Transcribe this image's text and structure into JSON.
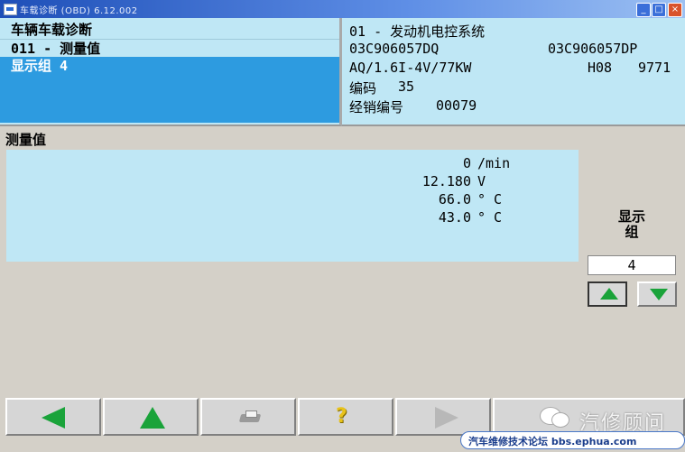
{
  "window": {
    "title": "车载诊断 (OBD) 6.12.002"
  },
  "left_header": {
    "rows": [
      "车辆车载诊断",
      "011 - 测量值"
    ],
    "selected": "显示组 4"
  },
  "right_header": {
    "system": "01 - 发动机电控系统",
    "part_left": "03C906057DQ",
    "part_right": "03C906057DP",
    "engine": "AQ/1.6I-4V/77KW",
    "code_a": "H08",
    "code_b": "9771",
    "coding_label": "编码",
    "coding_value": "35",
    "dealer_label": "经销编号",
    "dealer_value": "00079"
  },
  "section": {
    "title": "测量值"
  },
  "values": [
    {
      "value": "0",
      "unit": "/min"
    },
    {
      "value": "12.180",
      "unit": "V"
    },
    {
      "value": "66.0",
      "unit": "° C"
    },
    {
      "value": "43.0",
      "unit": "° C"
    }
  ],
  "display_group": {
    "label_line1": "显示",
    "label_line2": "组",
    "value": "4"
  },
  "toolbar": {
    "buttons": [
      {
        "name": "back",
        "icon": "arrow-left-icon"
      },
      {
        "name": "up",
        "icon": "arrow-up-icon"
      },
      {
        "name": "print",
        "icon": "printer-icon"
      },
      {
        "name": "help",
        "icon": "help-icon",
        "glyph": "?"
      },
      {
        "name": "forward",
        "icon": "arrow-right-icon"
      }
    ]
  },
  "watermark": {
    "text": "汽修顾问"
  },
  "footer": {
    "text": "汽车维修技术论坛 bbs.ephua.com"
  },
  "colors": {
    "panel": "#bfe7f5",
    "selected": "#2d9be0",
    "arrow": "#1aa33a"
  }
}
